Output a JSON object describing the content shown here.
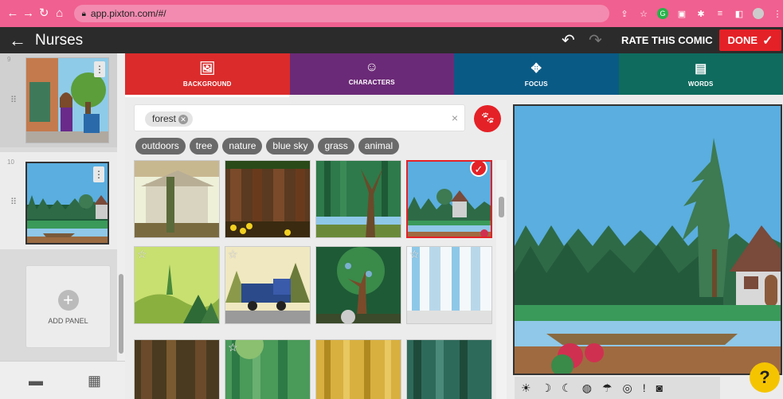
{
  "browser": {
    "url": "app.pixton.com/#/",
    "nav_icons": [
      "back-arrow-icon",
      "forward-arrow-icon",
      "reload-icon",
      "home-icon"
    ]
  },
  "app": {
    "title": "Nurses",
    "rate_label": "RATE THIS COMIC",
    "done_label": "DONE"
  },
  "sidebar": {
    "panels": [
      {
        "number": "9"
      },
      {
        "number": "10"
      }
    ],
    "add_panel_label": "ADD PANEL"
  },
  "tabs": [
    {
      "label": "BACKGROUND",
      "icon": "image-icon",
      "active": true
    },
    {
      "label": "CHARACTERS",
      "icon": "face-icon",
      "active": false
    },
    {
      "label": "FOCUS",
      "icon": "move-arrows-icon",
      "active": false
    },
    {
      "label": "WORDS",
      "icon": "speech-bubble-icon",
      "active": false
    }
  ],
  "search": {
    "chip": "forest",
    "clear": "×"
  },
  "tags": [
    "outdoors",
    "tree",
    "nature",
    "blue sky",
    "grass",
    "animal"
  ],
  "help_label": "?",
  "colors": {
    "browser_bar": "#f06090",
    "app_bar": "#2b2b2b",
    "done": "#e42127",
    "tab_background": "#db2b2b",
    "tab_characters": "#6b2a77",
    "tab_focus": "#0a5a86",
    "tab_words": "#0e6b5e",
    "help": "#f5c400"
  }
}
